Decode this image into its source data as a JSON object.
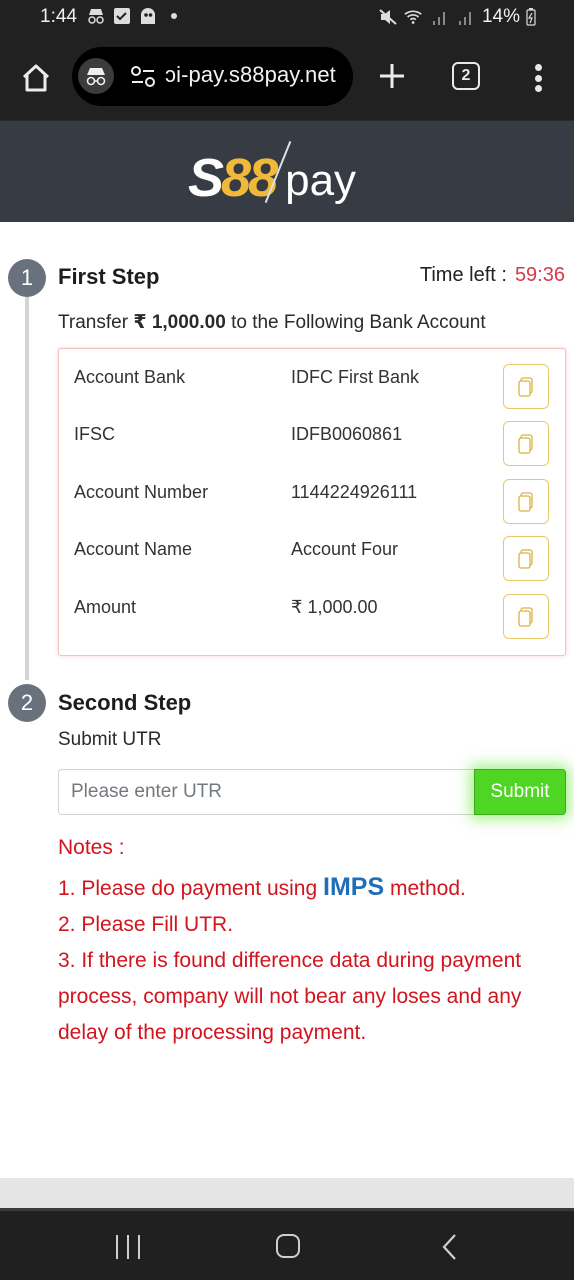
{
  "status_bar": {
    "time": "1:44",
    "battery": "14%"
  },
  "browser": {
    "url": "ɔi-pay.s88pay.net",
    "tab_count": "2"
  },
  "header": {
    "logo_s": "S",
    "logo_88": "88",
    "logo_pay": "pay",
    "brand_color": "#f0b93a"
  },
  "step1": {
    "number": "1",
    "title": "First Step",
    "timer_label": "Time left :",
    "timer_value": "59:36",
    "transfer_prefix": "Transfer ",
    "transfer_amount": "₹ 1,000.00",
    "transfer_suffix": " to the Following Bank Account",
    "rows": [
      {
        "label": "Account Bank",
        "value": "IDFC First Bank"
      },
      {
        "label": "IFSC",
        "value": "IDFB0060861"
      },
      {
        "label": "Account Number",
        "value": "1144224926111"
      },
      {
        "label": "Account Name",
        "value": "Account Four"
      },
      {
        "label": "Amount",
        "value": "₹ 1,000.00"
      }
    ]
  },
  "step2": {
    "number": "2",
    "title": "Second Step",
    "subtitle": "Submit UTR",
    "utr_placeholder": "Please enter UTR",
    "utr_value": "",
    "submit_label": "Submit",
    "submit_color": "#4fd524"
  },
  "notes": {
    "title": "Notes :",
    "note1_prefix": "1. Please do payment using ",
    "note1_highlight": "IMPS",
    "note1_suffix": " method.",
    "note2": "2. Please Fill UTR.",
    "note3": "3. If there is found difference data during payment process, company will not bear any loses and any delay of the processing payment.",
    "text_color": "#d2141e",
    "highlight_color": "#1f6fb8"
  }
}
